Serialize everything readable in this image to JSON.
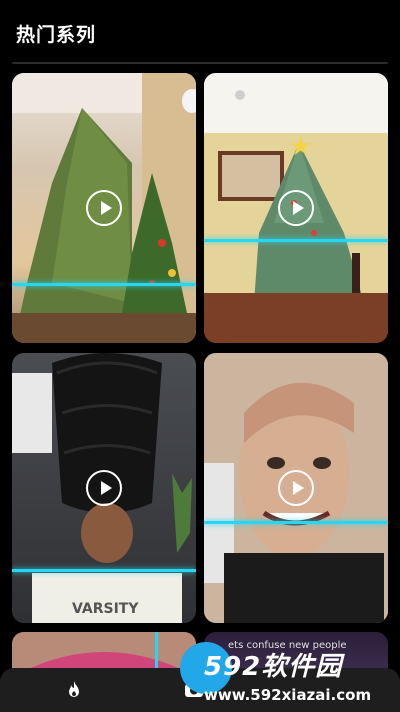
{
  "header": {
    "title": "热门系列"
  },
  "cards": [
    {
      "name": "tree-warp-1"
    },
    {
      "name": "tree-warp-2"
    },
    {
      "name": "hair-warp"
    },
    {
      "name": "face-stretch"
    },
    {
      "name": "pink-hair"
    },
    {
      "name": "text-effect"
    }
  ],
  "overlay_text": "ets confuse new people",
  "watermark": {
    "logo": "592软件园",
    "url": "www.592xiazai.com"
  },
  "tabs": [
    {
      "name": "hot",
      "icon": "flame-icon"
    },
    {
      "name": "camera",
      "icon": "camera-icon"
    }
  ],
  "colors": {
    "scanline": "#29d6f0",
    "background": "#000000",
    "tabbar": "#1e1e1e"
  }
}
